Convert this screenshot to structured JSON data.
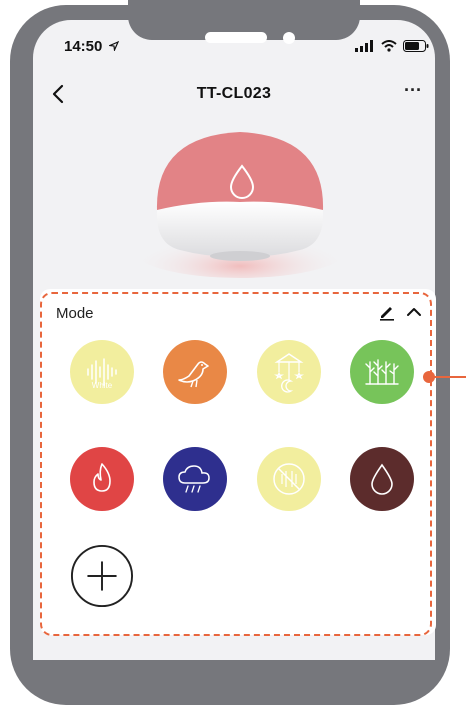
{
  "status_bar": {
    "time": "14:50"
  },
  "nav": {
    "title": "TT-CL023",
    "more_label": "···"
  },
  "mode_panel": {
    "label": "Mode",
    "modes": [
      {
        "name": "White",
        "color": "#f2ee9e"
      },
      {
        "name": "Bird",
        "color": "#e98846"
      },
      {
        "name": "Mobile",
        "color": "#f2ee9e"
      },
      {
        "name": "Forest",
        "color": "#77c45a"
      },
      {
        "name": "Fire",
        "color": "#e04545"
      },
      {
        "name": "Rain",
        "color": "#2e2f8e"
      },
      {
        "name": "Off",
        "color": "#f2ee9e"
      },
      {
        "name": "Drop",
        "color": "#5c2c2c"
      }
    ],
    "white_text": "White"
  },
  "colors": {
    "accent": "#e8663d",
    "device_top": "#e28386"
  }
}
